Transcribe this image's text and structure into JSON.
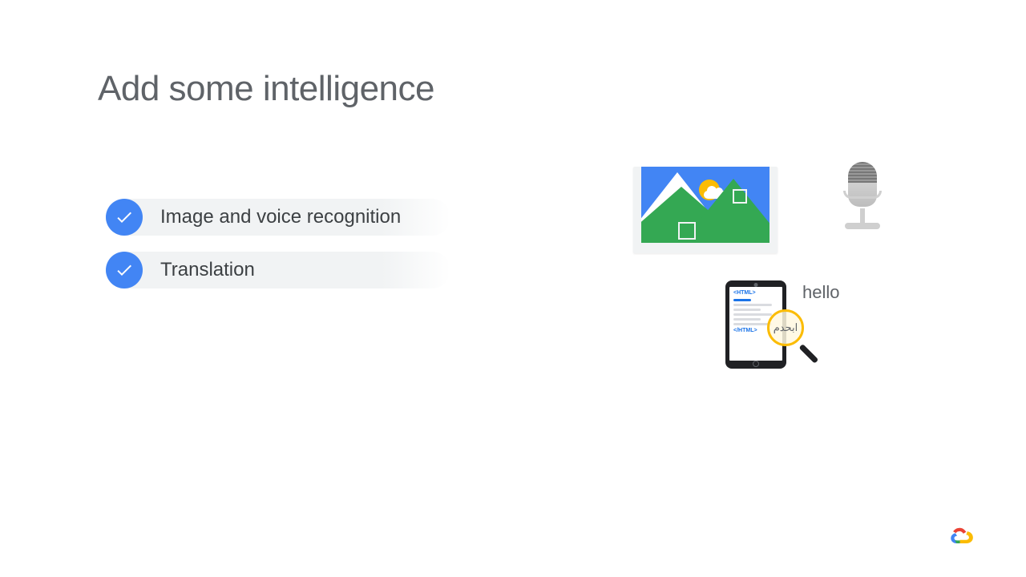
{
  "title": "Add some intelligence",
  "items": [
    {
      "label": "Image and voice recognition"
    },
    {
      "label": "Translation"
    }
  ],
  "graphics": {
    "translation_hello": "hello",
    "translation_arabic": "ابحدم",
    "html_open": "<HTML>",
    "html_close": "</HTML>"
  }
}
